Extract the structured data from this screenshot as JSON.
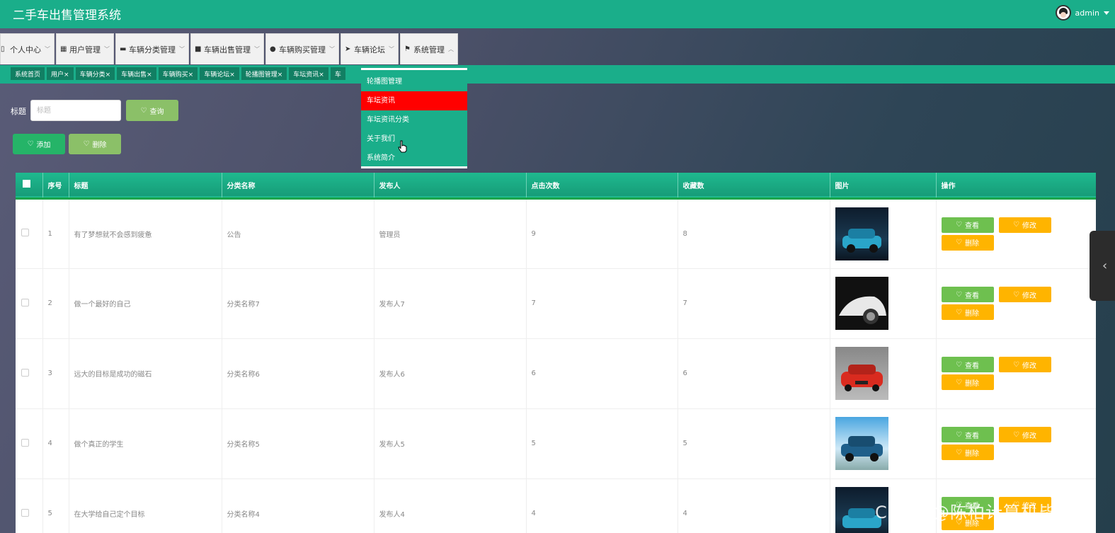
{
  "header": {
    "title": "二手车出售管理系统",
    "username": "admin"
  },
  "menu": [
    {
      "label": "个人中心",
      "icon": "book-icon"
    },
    {
      "label": "用户管理",
      "icon": "grid-icon"
    },
    {
      "label": "车辆分类管理",
      "icon": "monitor-icon"
    },
    {
      "label": "车辆出售管理",
      "icon": "briefcase-icon"
    },
    {
      "label": "车辆购买管理",
      "icon": "user-icon"
    },
    {
      "label": "车辆论坛",
      "icon": "send-icon"
    },
    {
      "label": "系统管理",
      "icon": "flag-icon"
    }
  ],
  "tabs": [
    "系统首页",
    "用户×",
    "车辆分类×",
    "车辆出售×",
    "车辆购买×",
    "车辆论坛×",
    "轮播图管理×",
    "车坛资讯×",
    "车"
  ],
  "dropdown": {
    "items": [
      "轮播图管理",
      "车坛资讯",
      "车坛资讯分类",
      "关于我们",
      "系统简介"
    ],
    "active_index": 1,
    "active_color": "#ff0000"
  },
  "search": {
    "label": "标题",
    "placeholder": "标题",
    "query_label": "查询"
  },
  "actions": {
    "add_label": "添加",
    "delete_label": "删除"
  },
  "table": {
    "columns": [
      "序号",
      "标题",
      "分类名称",
      "发布人",
      "点击次数",
      "收藏数",
      "图片",
      "操作"
    ],
    "op_labels": {
      "view": "查看",
      "edit": "修改",
      "delete": "删除"
    },
    "rows": [
      {
        "index": "1",
        "title": "有了梦想就不会感到疲惫",
        "category": "公告",
        "publisher": "管理员",
        "clicks": "9",
        "favorites": "8",
        "image": "blue-suv-garage"
      },
      {
        "index": "2",
        "title": "做一个最好的自己",
        "category": "分类名称7",
        "publisher": "发布人7",
        "clicks": "7",
        "favorites": "7",
        "image": "white-sports-car"
      },
      {
        "index": "3",
        "title": "远大的目标是成功的磁石",
        "category": "分类名称6",
        "publisher": "发布人6",
        "clicks": "6",
        "favorites": "6",
        "image": "red-sedan"
      },
      {
        "index": "4",
        "title": "做个真正的学生",
        "category": "分类名称5",
        "publisher": "发布人5",
        "clicks": "5",
        "favorites": "5",
        "image": "blue-suv-outdoor"
      },
      {
        "index": "5",
        "title": "在大学给自己定个目标",
        "category": "分类名称4",
        "publisher": "发布人4",
        "clicks": "4",
        "favorites": "4",
        "image": "blue-suv-garage"
      }
    ]
  },
  "watermark": "CSDN @陈柏计算机毕设",
  "colors": {
    "primary": "#1aae8a",
    "view_button": "#6ec04f",
    "edit_button": "#ffb400",
    "add_button": "#25b468"
  }
}
